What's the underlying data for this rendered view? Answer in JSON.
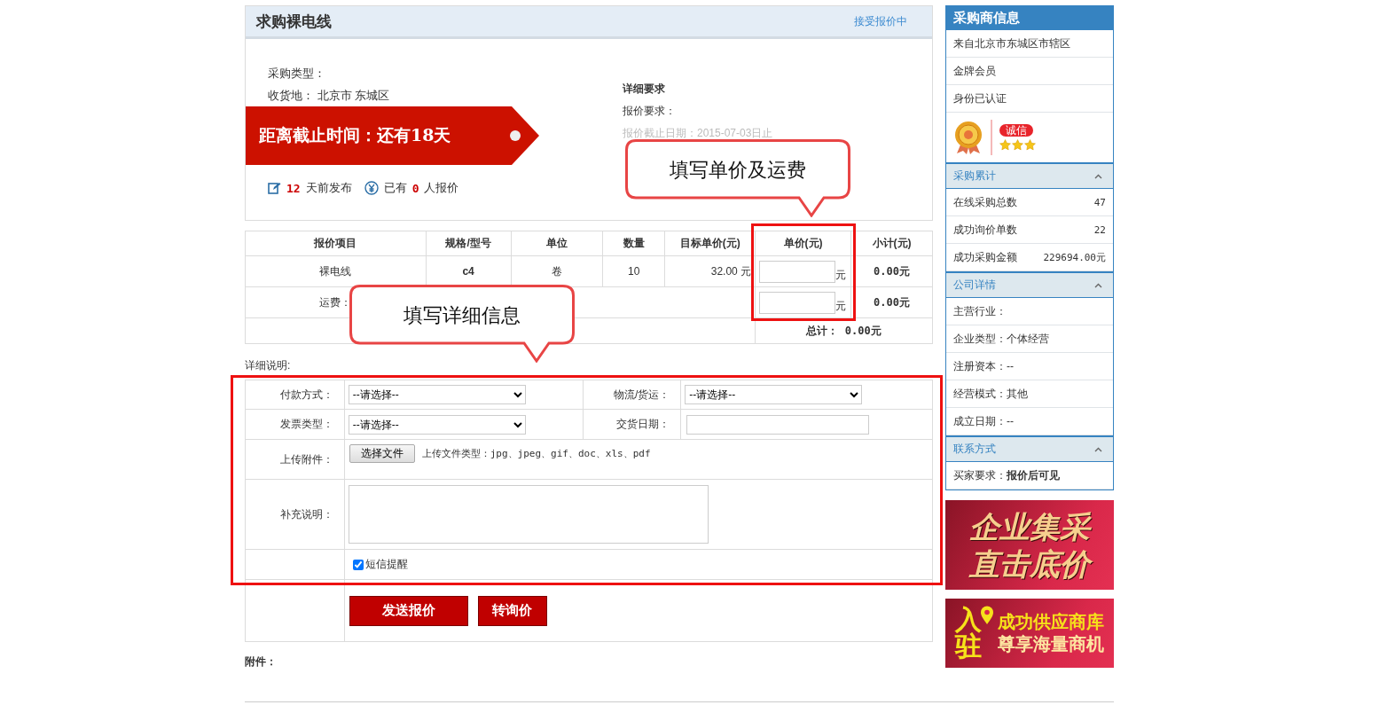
{
  "request": {
    "title": "求购裸电线",
    "status_link": "接受报价中",
    "fields": [
      {
        "label": "采购类型："
      },
      {
        "label": "收货地：",
        "value": "北京市 东城区"
      }
    ],
    "countdown": "距离截止时间：还有18天",
    "stats": {
      "days": "12",
      "days_text": "天前发布",
      "quotes_prefix": "已有",
      "quotes": "0",
      "quotes_text": "人报价"
    },
    "requirements": {
      "heading": "详细要求",
      "lines": [
        {
          "text": "报价要求：",
          "kind": "normal"
        },
        {
          "text": "报价截止日期：2015-07-03日止",
          "kind": "muted"
        }
      ]
    }
  },
  "quote_table": {
    "columns": [
      "报价项目",
      "规格/型号",
      "单位",
      "数量",
      "目标单价(元)",
      "单价(元)",
      "小计(元)"
    ],
    "item_row": {
      "name": "裸电线",
      "spec": "c4",
      "unit": "卷",
      "quantity": "10",
      "target_price": "32.00",
      "target_unit": "元",
      "price_unit": "元",
      "subtotal": "0.00元"
    },
    "freight_row": {
      "label": "运费：",
      "price_unit": "元",
      "subtotal": "0.00元"
    },
    "total": {
      "label": "总计：",
      "value": "0.00元"
    }
  },
  "detail_label": "详细说明:",
  "form": {
    "payment": {
      "label": "付款方式：",
      "value": "--请选择--"
    },
    "logistics": {
      "label": "物流/货运：",
      "value": "--请选择--"
    },
    "invoice": {
      "label": "发票类型：",
      "value": "--请选择--"
    },
    "delivery_date": {
      "label": "交货日期："
    },
    "upload": {
      "label": "上传附件：",
      "button": "选择文件",
      "hint": "上传文件类型：jpg、jpeg、gif、doc、xls、pdf"
    },
    "notes": {
      "label": "补充说明："
    },
    "sms": {
      "label": "短信提醒",
      "checked": true
    },
    "buttons": [
      {
        "label": "发送报价",
        "kind": "primary"
      },
      {
        "label": "转询价",
        "kind": "secondary"
      }
    ]
  },
  "attachment_label": "附件：",
  "callouts": [
    {
      "text": "填写单价及运费"
    },
    {
      "text": "填写详细信息"
    }
  ],
  "sidebar": {
    "title": "采购商信息",
    "items": [
      "来自北京市东城区市辖区",
      "金牌会员",
      "身份已认证"
    ],
    "badge": "诚信",
    "stars": 3,
    "sections": [
      {
        "title": "采购累计",
        "expanded": true,
        "rows": [
          {
            "label": "在线采购总数",
            "value": "47",
            "kind": "stat"
          },
          {
            "label": "成功询价单数",
            "value": "22",
            "kind": "stat"
          },
          {
            "label": "成功采购金额",
            "value": "229694.00元",
            "kind": "stat"
          }
        ]
      },
      {
        "title": "公司详情",
        "expanded": true,
        "rows": [
          {
            "text": "主营行业：",
            "kind": "line"
          },
          {
            "text": "企业类型：个体经营",
            "kind": "line"
          },
          {
            "text": "注册资本：--",
            "kind": "line"
          },
          {
            "text": "经营模式：其他",
            "kind": "line"
          },
          {
            "text": "成立日期：--",
            "kind": "line"
          }
        ]
      },
      {
        "title": "联系方式",
        "expanded": true,
        "rows": [
          {
            "text": "买家要求：**报价后可见**",
            "kind": "line"
          }
        ]
      }
    ]
  },
  "banners": [
    {
      "kind": "purchase",
      "lines": [
        "企业集采",
        "直击底价"
      ]
    },
    {
      "kind": "supplier",
      "side": [
        "入",
        "驻"
      ],
      "lines": [
        "成功供应商库",
        "尊享海量商机"
      ]
    }
  ]
}
